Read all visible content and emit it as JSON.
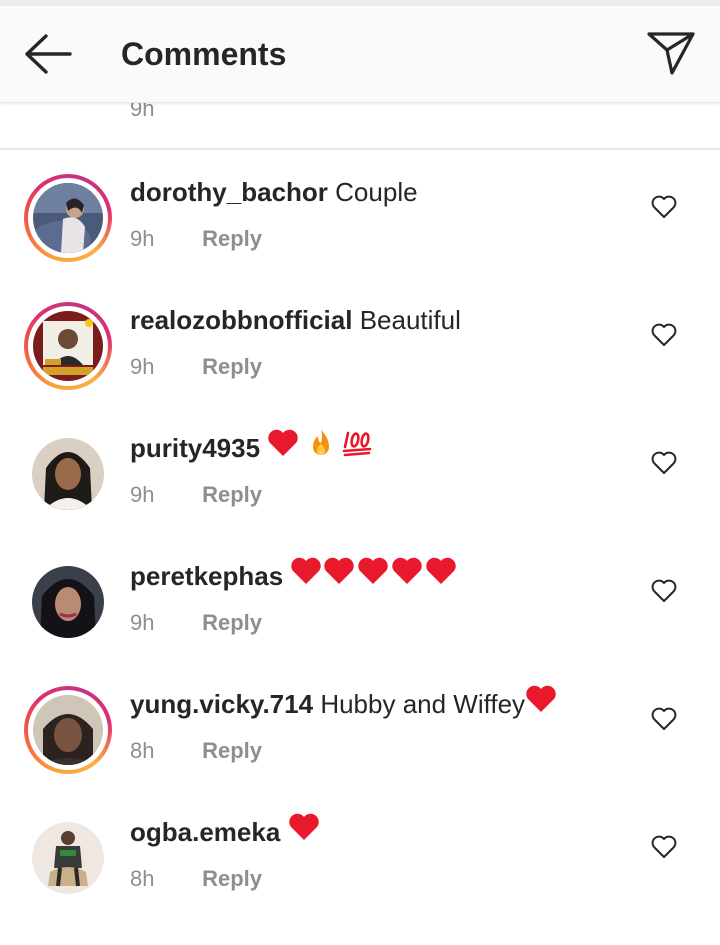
{
  "header": {
    "title": "Comments",
    "back_icon": "arrow-left-icon",
    "direct_icon": "paper-plane-icon"
  },
  "previous_comment": {
    "time": "9h"
  },
  "colors": {
    "text": "#262626",
    "muted": "#8e8e8e",
    "heart": "#e8192c",
    "header_bg": "#fafafa"
  },
  "comments": [
    {
      "username": "dorothy_bachor",
      "text": "Couple",
      "emoji": [],
      "time": "9h",
      "reply": "Reply",
      "story_ring": true,
      "avatar_icon": "profile-photo"
    },
    {
      "username": "realozobbnofficial",
      "text": "Beautiful",
      "emoji": [],
      "time": "9h",
      "reply": "Reply",
      "story_ring": true,
      "avatar_icon": "profile-photo"
    },
    {
      "username": "purity4935",
      "text": "",
      "emoji": [
        "red-heart",
        "fire",
        "hundred-points"
      ],
      "time": "9h",
      "reply": "Reply",
      "story_ring": false,
      "avatar_icon": "profile-photo"
    },
    {
      "username": "peretkephas",
      "text": "",
      "emoji": [
        "red-heart",
        "red-heart",
        "red-heart",
        "red-heart",
        "red-heart"
      ],
      "time": "9h",
      "reply": "Reply",
      "story_ring": false,
      "avatar_icon": "profile-photo"
    },
    {
      "username": "yung.vicky.714",
      "text": "Hubby and Wiffey",
      "emoji": [
        "red-heart"
      ],
      "time": "8h",
      "reply": "Reply",
      "story_ring": true,
      "avatar_icon": "profile-photo"
    },
    {
      "username": "ogba.emeka",
      "text": "",
      "emoji": [
        "red-heart"
      ],
      "time": "8h",
      "reply": "Reply",
      "story_ring": false,
      "avatar_icon": "profile-photo"
    }
  ]
}
